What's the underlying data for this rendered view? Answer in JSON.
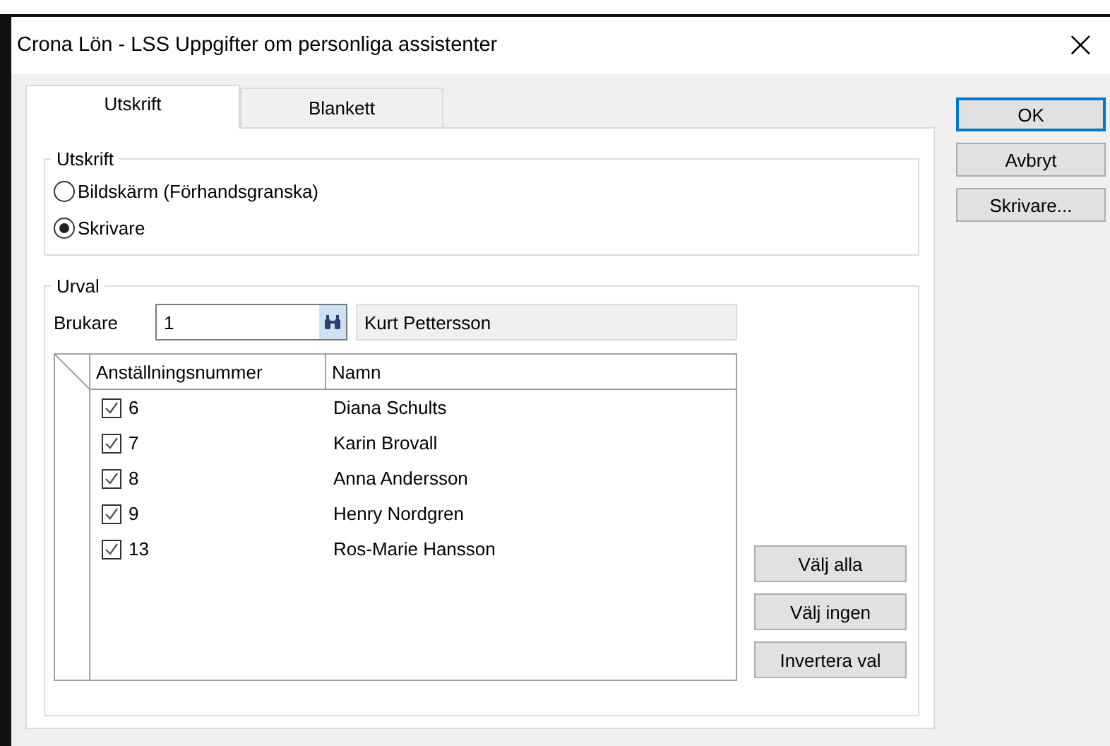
{
  "window": {
    "title": "Crona Lön - LSS Uppgifter om personliga assistenter",
    "close": "×"
  },
  "tabs": [
    {
      "label": "Utskrift",
      "selected": true
    },
    {
      "label": "Blankett",
      "selected": false
    }
  ],
  "output_group": {
    "title": "Utskrift",
    "options": [
      {
        "label": "Bildskärm (Förhandsgranska)",
        "selected": false
      },
      {
        "label": "Skrivare",
        "selected": true
      }
    ]
  },
  "selection_group": {
    "title": "Urval",
    "user": {
      "label": "Brukare",
      "value": "1",
      "name": "Kurt Pettersson"
    },
    "columns": [
      "Anställningsnummer",
      "Namn"
    ],
    "rows": [
      {
        "number": "6",
        "name": "Diana Schults",
        "checked": true
      },
      {
        "number": "7",
        "name": "Karin Brovall",
        "checked": true
      },
      {
        "number": "8",
        "name": "Anna Andersson",
        "checked": true
      },
      {
        "number": "9",
        "name": "Henry Nordgren",
        "checked": true
      },
      {
        "number": "13",
        "name": "Ros-Marie Hansson",
        "checked": true
      }
    ],
    "buttons": [
      "Välj alla",
      "Välj ingen",
      "Invertera val"
    ]
  },
  "buttons": [
    {
      "label": "OK",
      "default": true
    },
    {
      "label": "Avbryt",
      "default": false
    },
    {
      "label": "Skrivare...",
      "default": false
    }
  ]
}
